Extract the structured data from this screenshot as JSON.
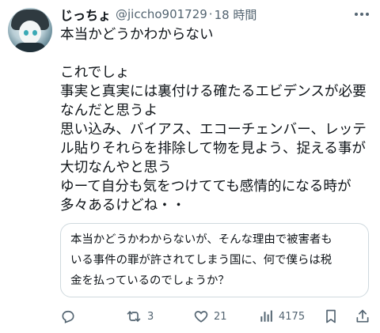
{
  "tweet": {
    "display_name": "じっちょ",
    "handle": "@jiccho901729",
    "separator": "·",
    "time": "18 時間",
    "lines": [
      "本当かどうかわからない",
      "",
      "これでしょ",
      "事実と真実には裏付ける確たるエビデンスが必要",
      "なんだと思うよ",
      "思い込み、バイアス、エコーチェンバー、レッテ",
      "ル貼りそれらを排除して物を見よう、捉える事が",
      "大切なんやと思う",
      "ゆーて自分も気をつけてても感情的になる時が",
      "多々あるけどね・・"
    ]
  },
  "quote": {
    "lines": [
      "本当かどうかわからないが、そんな理由で被害者も",
      "いる事件の罪が許されてしまう国に、何で僕らは税",
      "金を払っているのでしょうか？"
    ]
  },
  "actions": {
    "reply_icon": "reply-icon",
    "retweet_icon": "retweet-icon",
    "retweet_count": "3",
    "like_icon": "heart-icon",
    "like_count": "21",
    "views_icon": "views-icon",
    "views_count": "4175",
    "bookmark_icon": "bookmark-icon",
    "share_icon": "share-icon"
  },
  "colors": {
    "text": "#0f1419",
    "secondary": "#536471",
    "border": "#cfd9de"
  }
}
